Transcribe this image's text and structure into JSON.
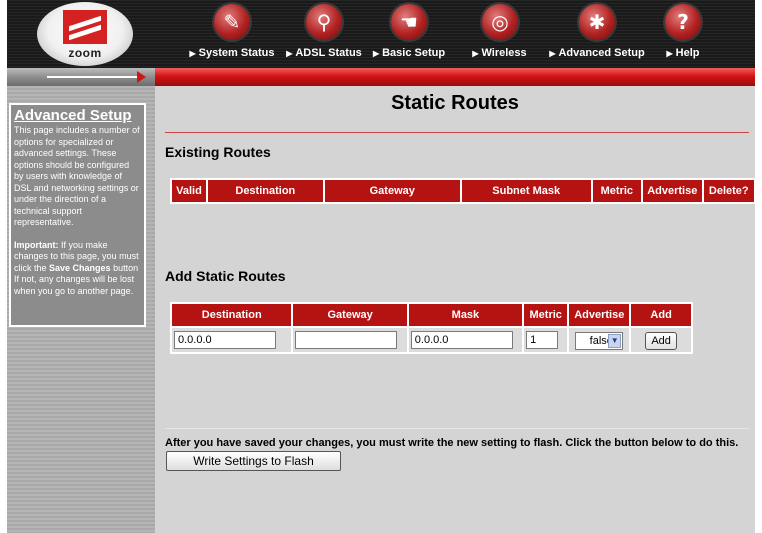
{
  "header": {
    "logo_text": "zoom",
    "nav": [
      {
        "label": "System Status",
        "icon": "document-icon"
      },
      {
        "label": "ADSL Status",
        "icon": "magnifier-icon"
      },
      {
        "label": "Basic Setup",
        "icon": "hand-icon"
      },
      {
        "label": "Wireless",
        "icon": "wireless-icon"
      },
      {
        "label": "Advanced Setup",
        "icon": "wrench-icon"
      },
      {
        "label": "Help",
        "icon": "question-icon"
      }
    ]
  },
  "sidebar": {
    "title": "Advanced Setup",
    "description": "This page includes a number of options for specialized or advanced settings. These options should be configured by users with knowledge of DSL and networking settings or under the direction of a technical support representative.",
    "important_label": "Important:",
    "important_pre": "If you make changes to this page, you must click the",
    "important_bold": "Save Changes",
    "important_post": "button If not, any changes will be lost when you go to another page."
  },
  "main": {
    "title": "Static Routes",
    "existing_heading": "Existing Routes",
    "existing_columns": [
      "Valid",
      "Destination",
      "Gateway",
      "Subnet Mask",
      "Metric",
      "Advertise",
      "Delete?"
    ],
    "add_heading": "Add Static Routes",
    "add_columns": [
      "Destination",
      "Gateway",
      "Mask",
      "Metric",
      "Advertise",
      "Add"
    ],
    "add_row": {
      "destination": "0.0.0.0",
      "gateway": "",
      "mask": "0.0.0.0",
      "metric": "1",
      "advertise": "false",
      "add_button": "Add"
    },
    "flash_text": "After you have saved your changes, you must write the new setting to flash. Click the button below to do this.",
    "flash_button": "Write Settings to Flash"
  },
  "colors": {
    "accent_red": "#b51212",
    "page_bg": "#d4d4d4",
    "sidebar_box": "#8c8c8c"
  }
}
